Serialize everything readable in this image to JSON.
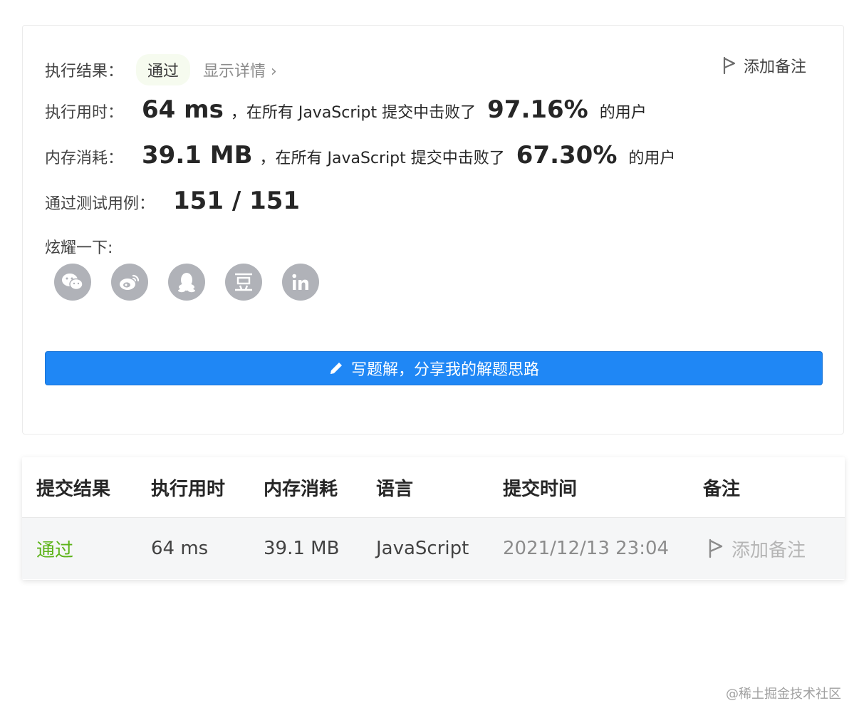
{
  "result_card": {
    "result_label": "执行结果：",
    "result_value": "通过",
    "show_details": "显示详情 ›",
    "add_note": "添加备注",
    "time_label": "执行用时：",
    "time_value": "64 ms",
    "time_mid": "，在所有 JavaScript 提交中击败了",
    "time_percent": "97.16%",
    "time_suffix": "的用户",
    "mem_label": "内存消耗：",
    "mem_value": "39.1 MB",
    "mem_mid": "，在所有 JavaScript 提交中击败了",
    "mem_percent": "67.30%",
    "mem_suffix": "的用户",
    "cases_label": "通过测试用例：",
    "cases_value": "151 / 151",
    "share_label": "炫耀一下:",
    "share_icons": [
      "wechat-icon",
      "weibo-icon",
      "qq-icon",
      "douban-icon",
      "linkedin-icon"
    ],
    "write_button": "写题解，分享我的解题思路"
  },
  "table": {
    "headers": [
      "提交结果",
      "执行用时",
      "内存消耗",
      "语言",
      "提交时间",
      "备注"
    ],
    "row": {
      "result": "通过",
      "time": "64 ms",
      "memory": "39.1 MB",
      "language": "JavaScript",
      "submitted": "2021/12/13 23:04",
      "note": "添加备注"
    }
  },
  "watermark": "@稀土掘金技术社区",
  "colors": {
    "accent_blue": "#1f87f5",
    "pass_green": "#5cb318",
    "icon_gray": "#b0b2b8"
  }
}
